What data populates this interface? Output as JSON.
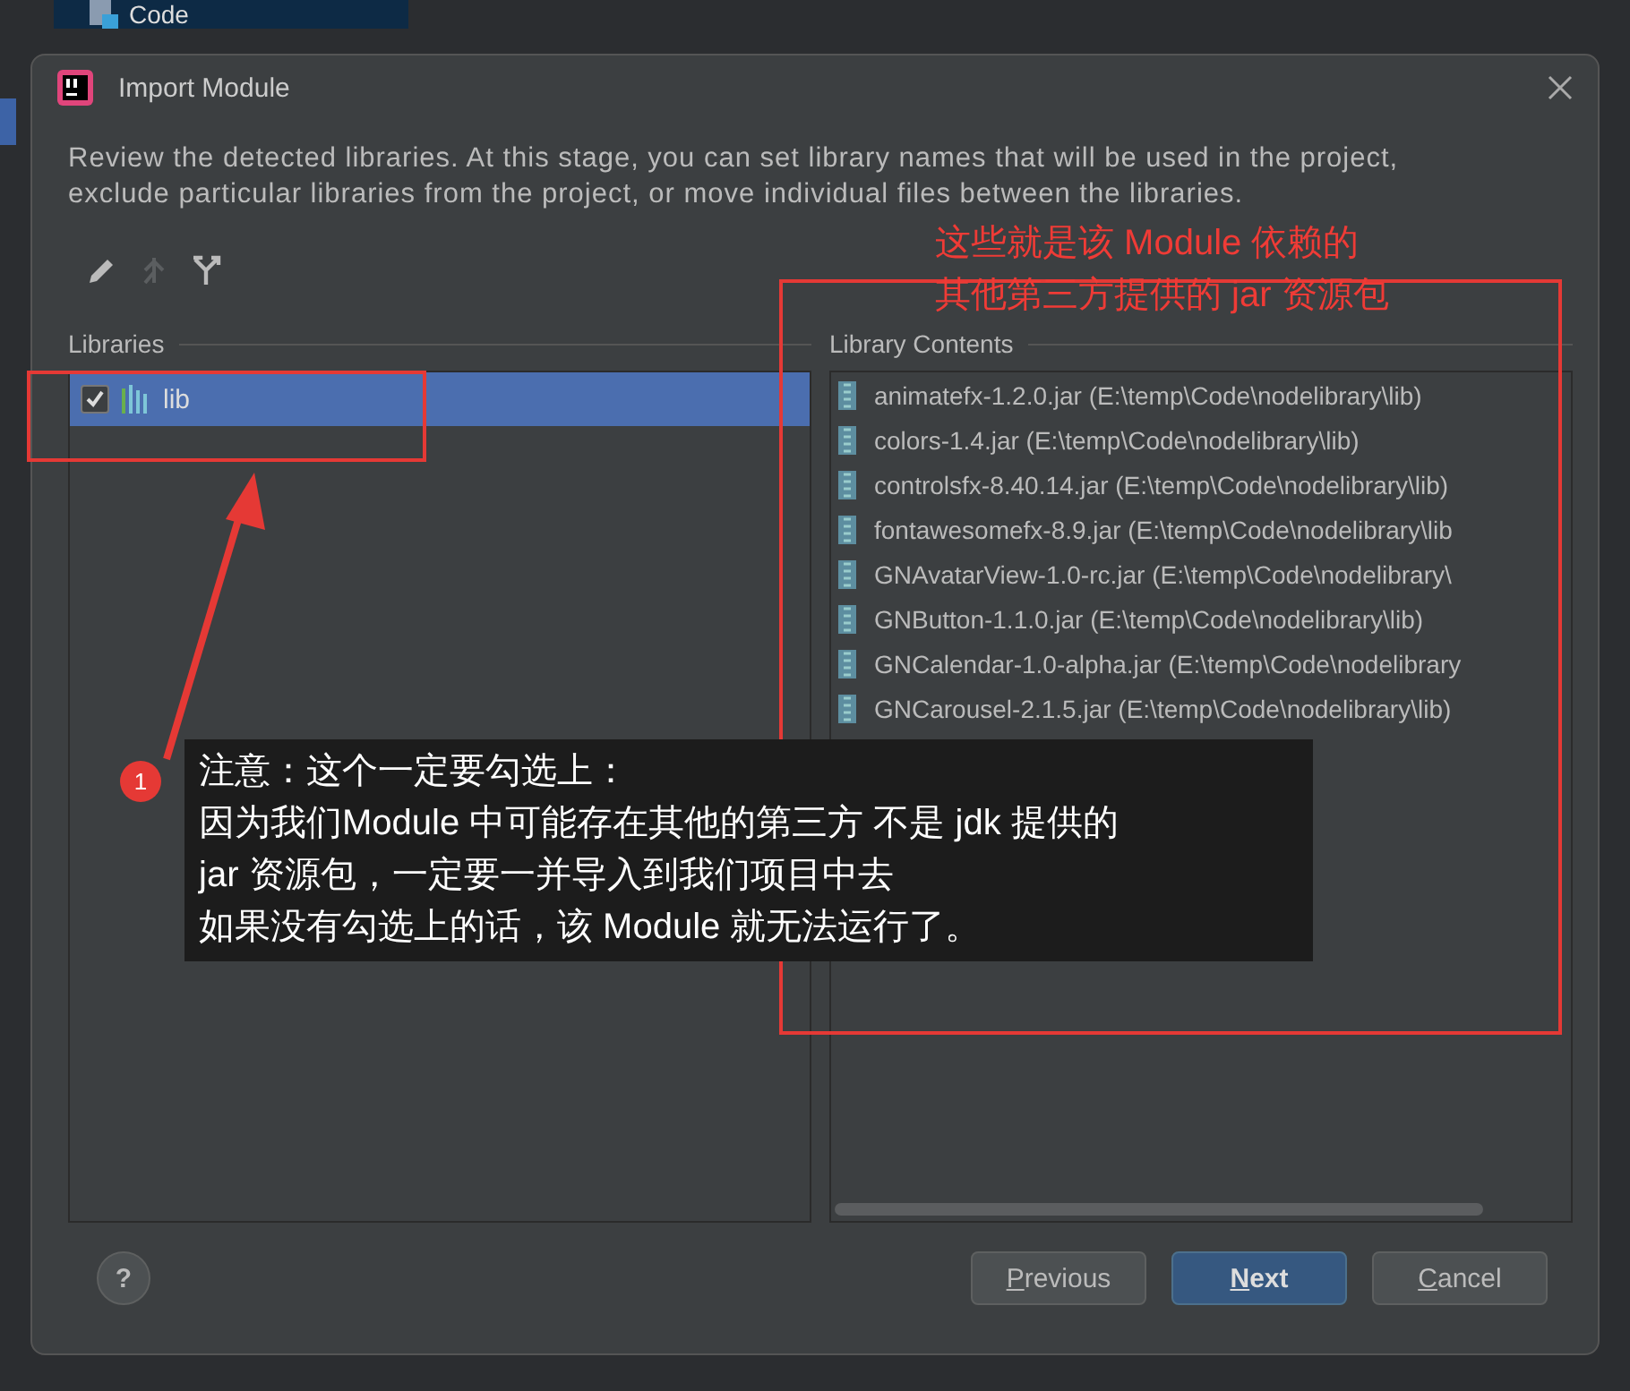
{
  "ide": {
    "project_item": "Code"
  },
  "dialog": {
    "title": "Import Module",
    "description_lines": [
      "Review the detected libraries. At this stage, you can set library names that will be used in the project,",
      "exclude particular libraries from the project, or move individual files between the libraries."
    ],
    "toolbar": [
      {
        "kind": "edit",
        "disabled": false
      },
      {
        "kind": "merge",
        "disabled": true
      },
      {
        "kind": "split",
        "disabled": false
      }
    ],
    "libraries": {
      "header": "Libraries",
      "items": [
        {
          "name": "lib",
          "checked": true,
          "selected": true
        }
      ]
    },
    "contents": {
      "header": "Library Contents",
      "items": [
        {
          "name": "animatefx-1.2.0.jar (E:\\temp\\Code\\nodelibrary\\lib)"
        },
        {
          "name": "colors-1.4.jar (E:\\temp\\Code\\nodelibrary\\lib)"
        },
        {
          "name": "controlsfx-8.40.14.jar (E:\\temp\\Code\\nodelibrary\\lib)"
        },
        {
          "name": "fontawesomefx-8.9.jar (E:\\temp\\Code\\nodelibrary\\lib"
        },
        {
          "name": "GNAvatarView-1.0-rc.jar (E:\\temp\\Code\\nodelibrary\\"
        },
        {
          "name": "GNButton-1.1.0.jar (E:\\temp\\Code\\nodelibrary\\lib)"
        },
        {
          "name": "GNCalendar-1.0-alpha.jar (E:\\temp\\Code\\nodelibrary"
        },
        {
          "name": "GNCarousel-2.1.5.jar (E:\\temp\\Code\\nodelibrary\\lib)"
        }
      ]
    },
    "help": "?",
    "buttons": [
      {
        "label": "Previous",
        "primary": false
      },
      {
        "label": "Next",
        "primary": true
      },
      {
        "label": "Cancel",
        "primary": false
      }
    ]
  },
  "annotations": {
    "contents_note": [
      "这些就是该 Module 依赖的",
      "其他第三方提供的 jar 资源包"
    ],
    "callout": {
      "badge": "1",
      "lines": [
        "注意：这个一定要勾选上：",
        "因为我们Module 中可能存在其他的第三方 不是 jdk 提供的",
        "jar 资源包，一定要一并导入到我们项目中去",
        "如果没有勾选上的话，该 Module 就无法运行了。"
      ]
    }
  }
}
